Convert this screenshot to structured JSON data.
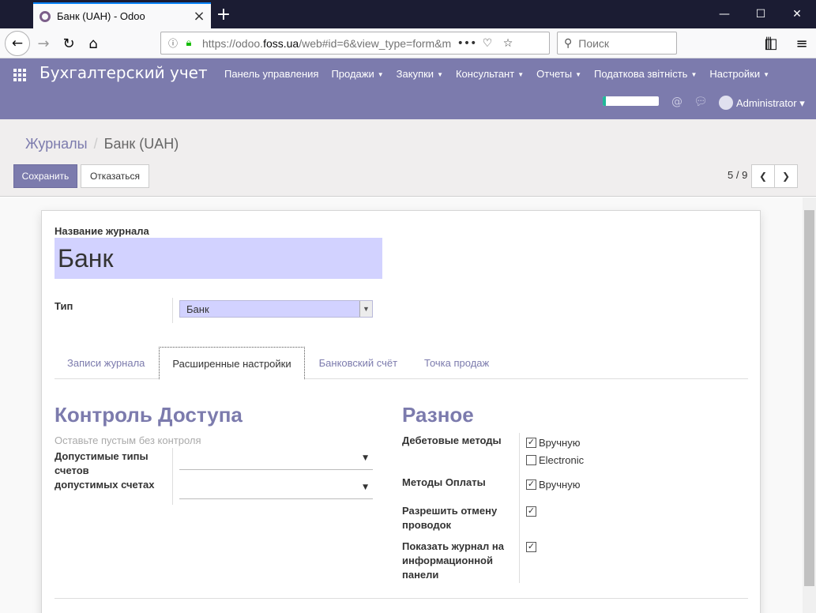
{
  "browser": {
    "tab_title": "Банк (UAH) - Odoo",
    "url_prefix": "https://odoo.",
    "url_domain": "foss.ua",
    "url_suffix": "/web#id=6&view_type=form&m",
    "search_placeholder": "Поиск"
  },
  "topbar": {
    "brand": "Бухгалтерский учет",
    "menu": [
      {
        "label": "Панель управления",
        "dropdown": false
      },
      {
        "label": "Продажи",
        "dropdown": true
      },
      {
        "label": "Закупки",
        "dropdown": true
      },
      {
        "label": "Консультант",
        "dropdown": true
      },
      {
        "label": "Отчеты",
        "dropdown": true
      },
      {
        "label": "Податкова звітність",
        "dropdown": true
      },
      {
        "label": "Настройки",
        "dropdown": true
      }
    ],
    "user": "Administrator",
    "progress": 0.06
  },
  "control": {
    "breadcrumb_parent": "Журналы",
    "breadcrumb_current": "Банк (UAH)",
    "save_label": "Сохранить",
    "discard_label": "Отказаться",
    "pager": "5 / 9"
  },
  "form": {
    "name_label": "Название журнала",
    "name_value": "Банк",
    "type_label": "Тип",
    "type_value": "Банк",
    "tabs": [
      "Записи журнала",
      "Расширенные настройки",
      "Банковский счёт",
      "Точка продаж"
    ],
    "active_tab": 1,
    "access": {
      "title": "Контроль Доступа",
      "hint": "Оставьте пустым без контроля",
      "allowed_types_label": "Допустимые типы счетов",
      "allowed_accounts_label": "допустимых счетах"
    },
    "misc": {
      "title": "Разное",
      "debit_label": "Дебетовые методы",
      "debit_manual": "Вручную",
      "debit_electronic": "Electronic",
      "payment_label": "Методы Оплаты",
      "payment_manual": "Вручную",
      "cancel_label": "Разрешить отмену проводок",
      "dashboard_label": "Показать журнал на информационной панели"
    }
  }
}
